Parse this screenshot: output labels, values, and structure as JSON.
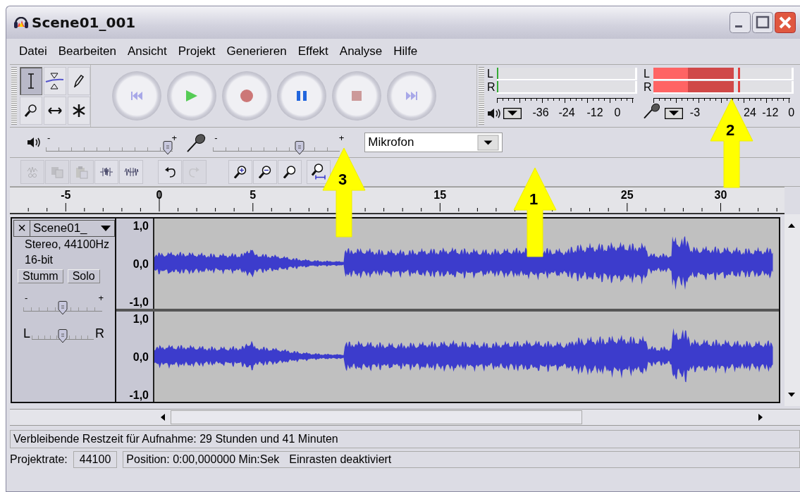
{
  "window": {
    "title": "Scene01_001"
  },
  "menu": [
    "Datei",
    "Bearbeiten",
    "Ansicht",
    "Projekt",
    "Generieren",
    "Effekt",
    "Analyse",
    "Hilfe"
  ],
  "tools": [
    {
      "kind": "ibeam",
      "selected": true
    },
    {
      "kind": "envelope",
      "selected": false
    },
    {
      "kind": "pencil",
      "selected": false
    },
    {
      "kind": "zoom",
      "selected": false
    },
    {
      "kind": "timeshift",
      "selected": false
    },
    {
      "kind": "multi",
      "selected": false
    }
  ],
  "transport": [
    {
      "kind": "rewind"
    },
    {
      "kind": "play"
    },
    {
      "kind": "record"
    },
    {
      "kind": "pause"
    },
    {
      "kind": "stop"
    },
    {
      "kind": "forward"
    }
  ],
  "meters": [
    {
      "kind": "playback",
      "channels": [
        {
          "label": "L",
          "level": 0
        },
        {
          "label": "R",
          "level": 0
        }
      ],
      "scale": [
        "-36",
        "-24",
        "-12",
        "0"
      ]
    },
    {
      "kind": "record",
      "channels": [
        {
          "label": "L",
          "level": 0.58
        },
        {
          "label": "R",
          "level": 0.58
        }
      ],
      "scale": [
        "-3",
        "24",
        "-12",
        "0"
      ]
    }
  ],
  "mixer": {
    "output": {
      "level": 0.96,
      "minus": "-",
      "plus": "+"
    },
    "input": {
      "level": 0.68,
      "minus": "-",
      "plus": "+"
    },
    "source": {
      "value": "Mikrofon"
    }
  },
  "edit_tools": [
    {
      "kind": "cut",
      "disabled": true
    },
    {
      "kind": "copy",
      "disabled": true
    },
    {
      "kind": "paste",
      "disabled": true
    },
    {
      "kind": "trim",
      "disabled": false
    },
    {
      "kind": "silence",
      "disabled": false
    },
    {
      "kind": "undo",
      "disabled": false
    },
    {
      "kind": "redo",
      "disabled": true
    },
    {
      "kind": "zoomin",
      "disabled": false
    },
    {
      "kind": "zoomout",
      "disabled": false
    },
    {
      "kind": "fitsel",
      "disabled": false
    },
    {
      "kind": "fit",
      "disabled": false
    }
  ],
  "ruler": {
    "labels": [
      "-5",
      "0",
      "5",
      "15",
      "25",
      "30"
    ]
  },
  "track": {
    "close": "×",
    "name": "Scene01_",
    "info": [
      "Stereo, 44100Hz",
      "16-bit"
    ],
    "buttons": [
      {
        "label": "Stumm",
        "selected": false
      },
      {
        "label": "Solo",
        "selected": false
      }
    ],
    "gain": {
      "level": 0.5,
      "minus": "-",
      "plus": "+"
    },
    "pan": {
      "level": 0.5,
      "left": "L",
      "right": "R"
    },
    "channels": [
      {
        "scale": [
          "1,0",
          "0,0",
          "-1,0"
        ]
      },
      {
        "scale": [
          "1,0",
          "0,0",
          "-1,0"
        ]
      }
    ]
  },
  "status": {
    "message": "Verbleibende Restzeit für Aufnahme: 29 Stunden und 41 Minuten",
    "rate_label": "Projektrate:",
    "rate": "44100",
    "position": "Position: 0:00,000000 Min:Sek",
    "snap": "Einrasten deaktiviert"
  },
  "annotations": [
    {
      "label": "1"
    },
    {
      "label": "2"
    },
    {
      "label": "3"
    }
  ]
}
